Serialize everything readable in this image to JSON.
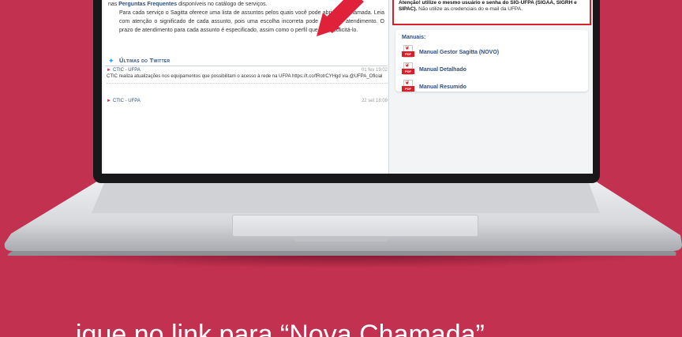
{
  "page": {
    "intro_lead": "nas ",
    "intro_link": "Perguntas Frequentes",
    "intro_tail": " disponíveis no catálogo de serviços.",
    "intro_paragraph": "Para cada serviço o Sagitta oferece uma lista de assuntos pelos quais você pode abrir uma chamada. Leia com atenção o significado de cada assunto, pois uma escolha incorreta pode atrasar o atendimento. O prazo de atendimento para cada assunto é especificado, assim como o perfil que pode solicitá-lo."
  },
  "twitter": {
    "title": "Últimas do Twitter",
    "tweets": [
      {
        "author": "CTIC - UFPA",
        "date": "01 fev 19:02",
        "text": "CTIC realiza atualizações nos equipamentos que possibilitam o acesso à rede na UFPA https://t.co/fRotrCYHgd via @UFPA_Oficial"
      },
      {
        "author": "CTIC - UFPA",
        "date": "22 set 18:09",
        "text": ""
      }
    ]
  },
  "notice": {
    "bold": "Atenção! utilize o mesmo usuário e senha do SIG-UFPA (SIGAA, SIGRH e SIPAC).",
    "rest": " Não utilize as credenciais do e-mail da UFPA."
  },
  "manuals": {
    "title": "Manuais:",
    "items": [
      {
        "label": "Manual Gestor Sagitta (NOVO)",
        "icon": "pdf-icon"
      },
      {
        "label": "Manual Detalhado",
        "icon": "pdf-icon"
      },
      {
        "label": "Manual Resumido",
        "icon": "pdf-icon"
      }
    ],
    "pdf_tag": "PDF"
  },
  "caption": {
    "text": "…ique no link para “Nova Chamada”"
  },
  "colors": {
    "background": "#c2314f",
    "link": "#2a4f86",
    "alert": "#d9202a",
    "twitter": "#1da1f2"
  }
}
